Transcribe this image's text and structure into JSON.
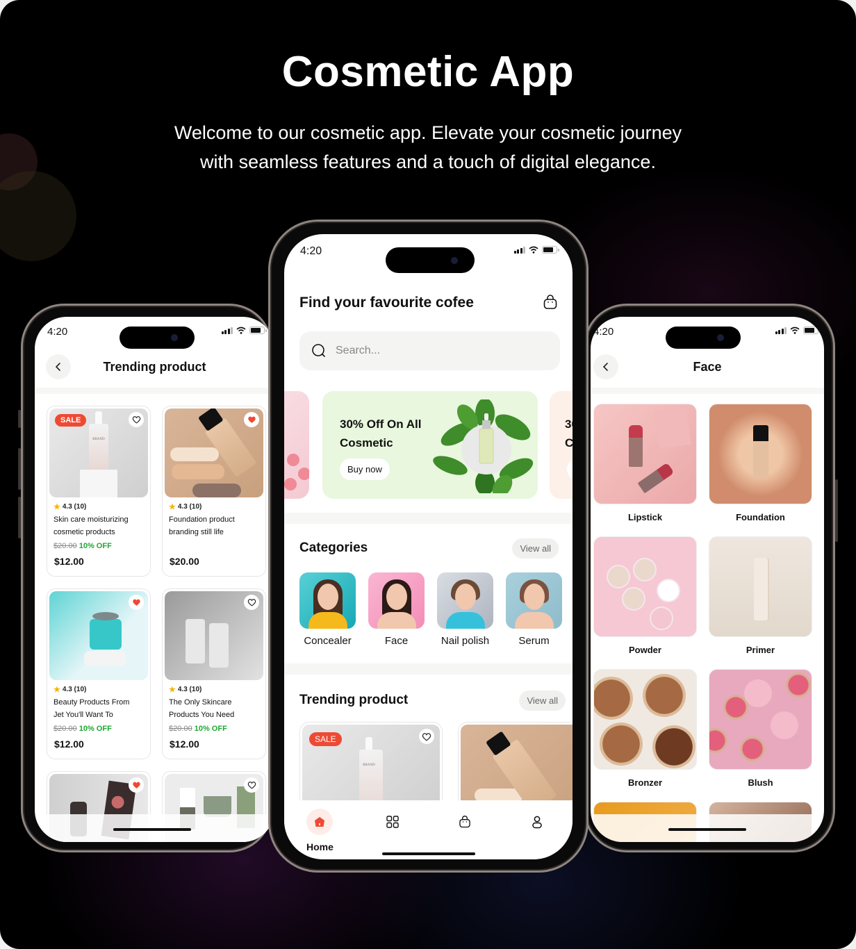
{
  "hero": {
    "title": "Cosmetic App",
    "subtitle_line1": "Welcome to our cosmetic app. Elevate your cosmetic journey",
    "subtitle_line2": "with seamless features and a touch of digital elegance."
  },
  "colors": {
    "accent": "#ee4a33",
    "discount_green": "#1fa732",
    "star": "#f5b400",
    "banner_green": "#e8f7de"
  },
  "status_bar": {
    "time": "4:20"
  },
  "left_phone": {
    "title": "Trending product",
    "back_icon": "chevron-left-icon",
    "products": [
      {
        "name_line1": "Skin care moisturizing",
        "name_line2": "cosmetic products",
        "rating": "4.3 (10)",
        "old_price": "$20.00",
        "discount": "10% OFF",
        "price": "$12.00",
        "badge": "SALE",
        "favorited": false
      },
      {
        "name_line1": "Foundation product",
        "name_line2": "branding still life",
        "rating": "4.3 (10)",
        "old_price": "",
        "discount": "",
        "price": "$20.00",
        "badge": "",
        "favorited": true
      },
      {
        "name_line1": "Beauty Products From",
        "name_line2": "Jet You'll Want To",
        "rating": "4.3 (10)",
        "old_price": "$20.00",
        "discount": "10% OFF",
        "price": "$12.00",
        "badge": "",
        "favorited": true
      },
      {
        "name_line1": "The Only Skincare",
        "name_line2": "Products You Need",
        "rating": "4.3 (10)",
        "old_price": "$20.00",
        "discount": "10% OFF",
        "price": "$12.00",
        "badge": "",
        "favorited": false
      },
      {
        "favorited": true
      },
      {
        "favorited": false
      }
    ]
  },
  "center_phone": {
    "title": "Find your favourite cofee",
    "cart_icon": "shopping-bag-icon",
    "search": {
      "placeholder": "Search...",
      "value": ""
    },
    "banner": {
      "title_line1": "30% Off On All",
      "title_line2": "Cosmetic",
      "button": "Buy now",
      "next_peek_line1": "30",
      "next_peek_line2": "C"
    },
    "categories": {
      "title": "Categories",
      "view_all": "View all",
      "items": [
        "Concealer",
        "Face",
        "Nail polish",
        "Serum"
      ]
    },
    "trending": {
      "title": "Trending product",
      "view_all": "View all",
      "first_badge": "SALE"
    },
    "tabbar": {
      "active": "Home",
      "items": [
        {
          "icon": "home-icon",
          "label": "Home"
        },
        {
          "icon": "grid-icon",
          "label": ""
        },
        {
          "icon": "shopping-bag-icon",
          "label": ""
        },
        {
          "icon": "profile-icon",
          "label": ""
        }
      ]
    }
  },
  "right_phone": {
    "title": "Face",
    "back_icon": "chevron-left-icon",
    "items": [
      "Lipstick",
      "Foundation",
      "Powder",
      "Primer",
      "Bronzer",
      "Blush"
    ]
  }
}
